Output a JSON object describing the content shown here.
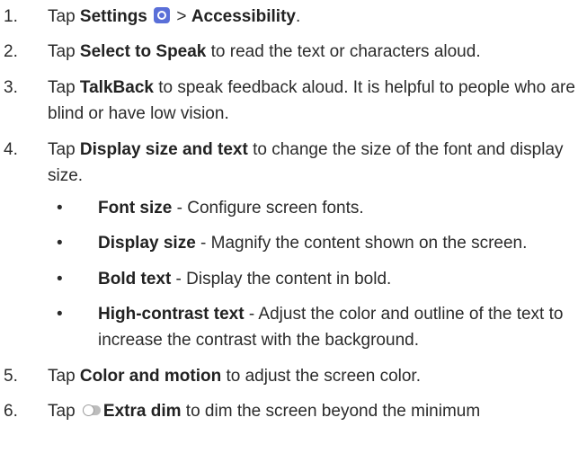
{
  "steps": [
    {
      "num": "1.",
      "pre": "Tap ",
      "bold1": "Settings",
      "mid": " > ",
      "bold2": "Accessibility",
      "post": "."
    },
    {
      "num": "2.",
      "pre": "Tap ",
      "bold": "Select to Speak",
      "post": " to read the text or characters aloud."
    },
    {
      "num": "3.",
      "pre": "Tap ",
      "bold": "TalkBack",
      "post": " to speak feedback aloud. It is helpful to people who are blind or have low vision."
    },
    {
      "num": "4.",
      "pre": "Tap ",
      "bold": "Display size and text",
      "post": " to change the size of the font and display size."
    },
    {
      "num": "5.",
      "pre": "Tap ",
      "bold": "Color and motion",
      "post": "  to adjust the screen color."
    },
    {
      "num": "6.",
      "pre": "Tap ",
      "bold": "Extra dim",
      "post": " to dim the screen beyond the minimum"
    }
  ],
  "subitems": [
    {
      "bullet": "•",
      "bold": "Font size",
      "post": " - Configure screen fonts."
    },
    {
      "bullet": "•",
      "bold": "Display size",
      "post": " - Magnify the content shown on the screen."
    },
    {
      "bullet": "•",
      "bold": "Bold text",
      "post": " - Display the content in bold."
    },
    {
      "bullet": "•",
      "bold": "High-contrast text",
      "post": " - Adjust the color and outline of the text to increase the contrast with the background."
    }
  ],
  "icons": {
    "settings": "settings-gear-icon",
    "toggle": "toggle-icon"
  }
}
